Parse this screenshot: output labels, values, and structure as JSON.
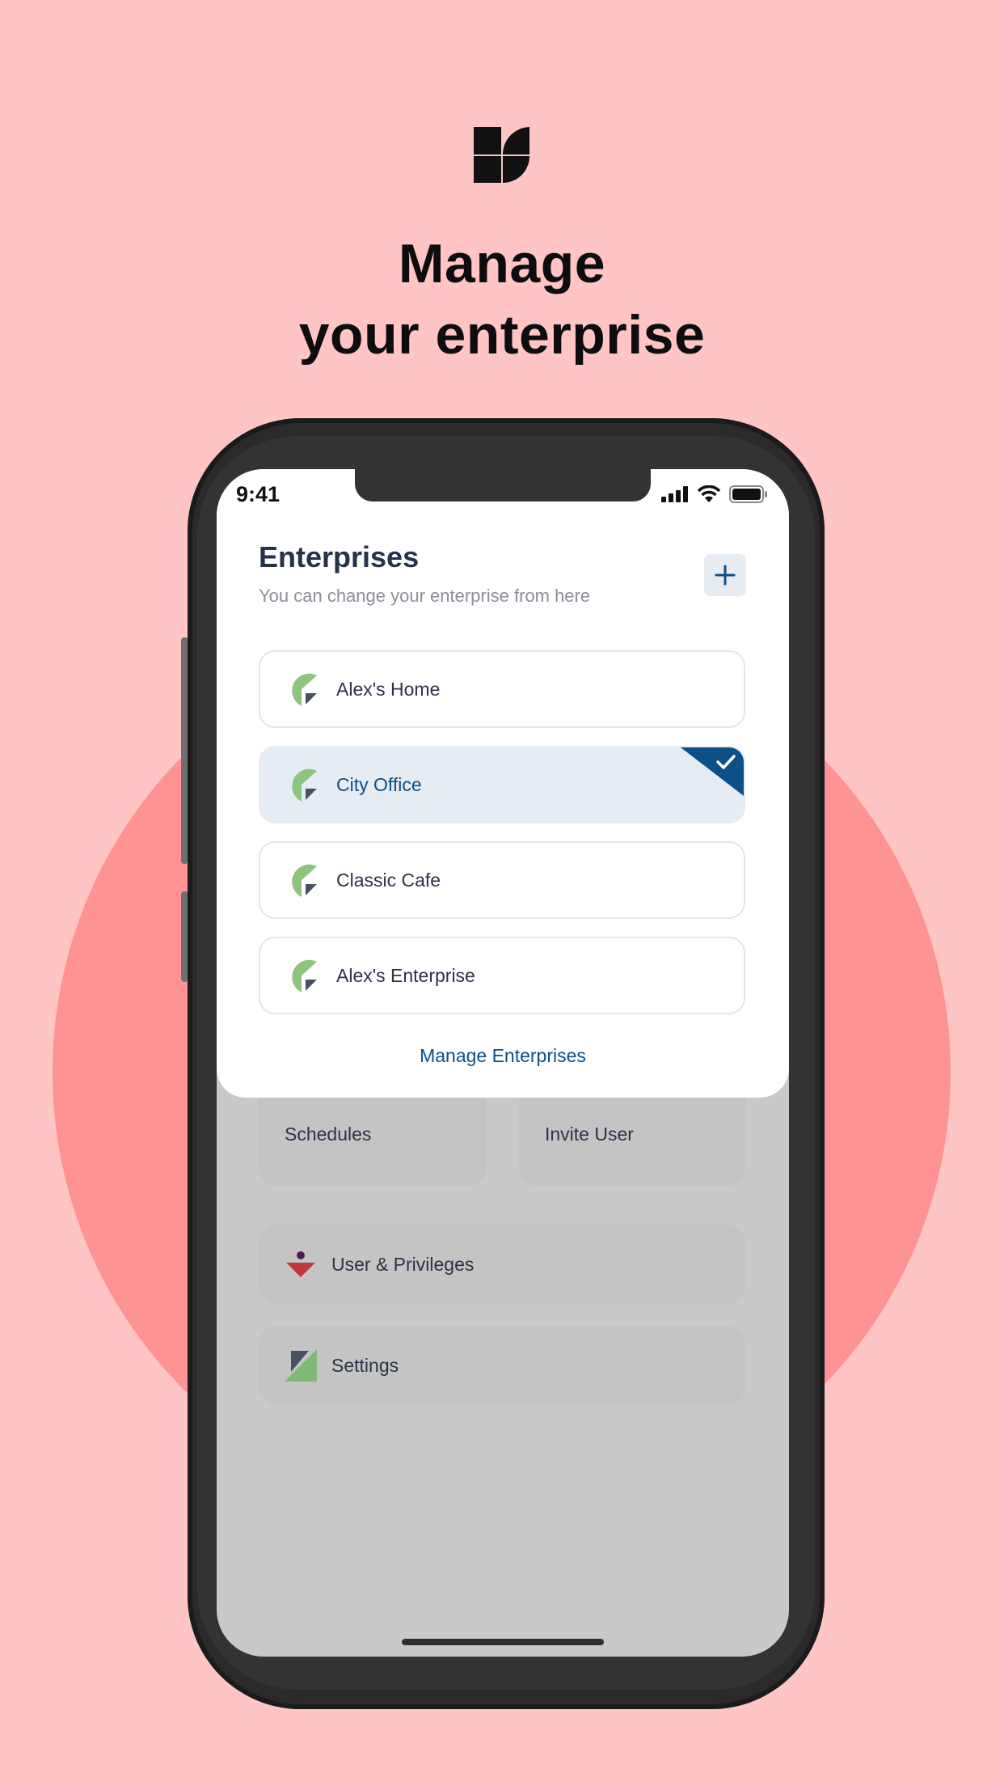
{
  "headline": {
    "line1": "Manage",
    "line2": "your enterprise"
  },
  "status_bar": {
    "time": "9:41"
  },
  "sheet": {
    "title": "Enterprises",
    "subtitle": "You can change your enterprise from here",
    "add_icon": "plus-icon",
    "enterprises": [
      {
        "label": "Alex's Home",
        "selected": false
      },
      {
        "label": "City Office",
        "selected": true
      },
      {
        "label": "Classic Cafe",
        "selected": false
      },
      {
        "label": "Alex's Enterprise",
        "selected": false
      }
    ],
    "manage_link": "Manage Enterprises"
  },
  "menu": {
    "tiles": [
      {
        "label": "Schedules"
      },
      {
        "label": "Invite User"
      }
    ],
    "rows": [
      {
        "label": "User & Privileges",
        "icon": "user-privileges-icon"
      },
      {
        "label": "Settings",
        "icon": "settings-icon"
      }
    ]
  },
  "colors": {
    "background": "#ffc4c4",
    "circle": "#ff9393",
    "accent": "#0c5087",
    "selected_bg": "#e6ecf3",
    "enterprise_icon_green": "#8ec47c"
  }
}
